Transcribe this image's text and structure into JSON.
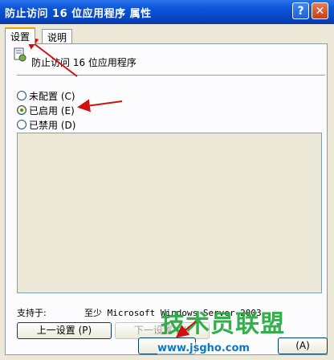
{
  "window": {
    "title": "防止访问 16 位应用程序 属性",
    "help_glyph": "?",
    "close_glyph": "✕"
  },
  "tabs": [
    {
      "label": "设置",
      "active": true
    },
    {
      "label": "说明",
      "active": false
    }
  ],
  "policy": {
    "name": "防止访问 16 位应用程序",
    "icon": "policy-settings-icon"
  },
  "options": [
    {
      "label": "未配置 (C)",
      "checked": false
    },
    {
      "label": "已启用 (E)",
      "checked": true
    },
    {
      "label": "已禁用 (D)",
      "checked": false
    }
  ],
  "support": {
    "label": "支持于:",
    "value": "至少 Microsoft Windows Server 2003"
  },
  "buttons": {
    "prev": "上一设置 (P)",
    "next": "下一设置 (N)",
    "ok": "",
    "apply": "(A)"
  },
  "watermark": {
    "text": "技术员联盟",
    "url": "www.jsgho.com"
  },
  "colors": {
    "titlebar": "#0a55d8",
    "dialog_bg": "#ece9d8",
    "annotation_arrow": "#d01010",
    "watermark_green": "#1ea838"
  }
}
